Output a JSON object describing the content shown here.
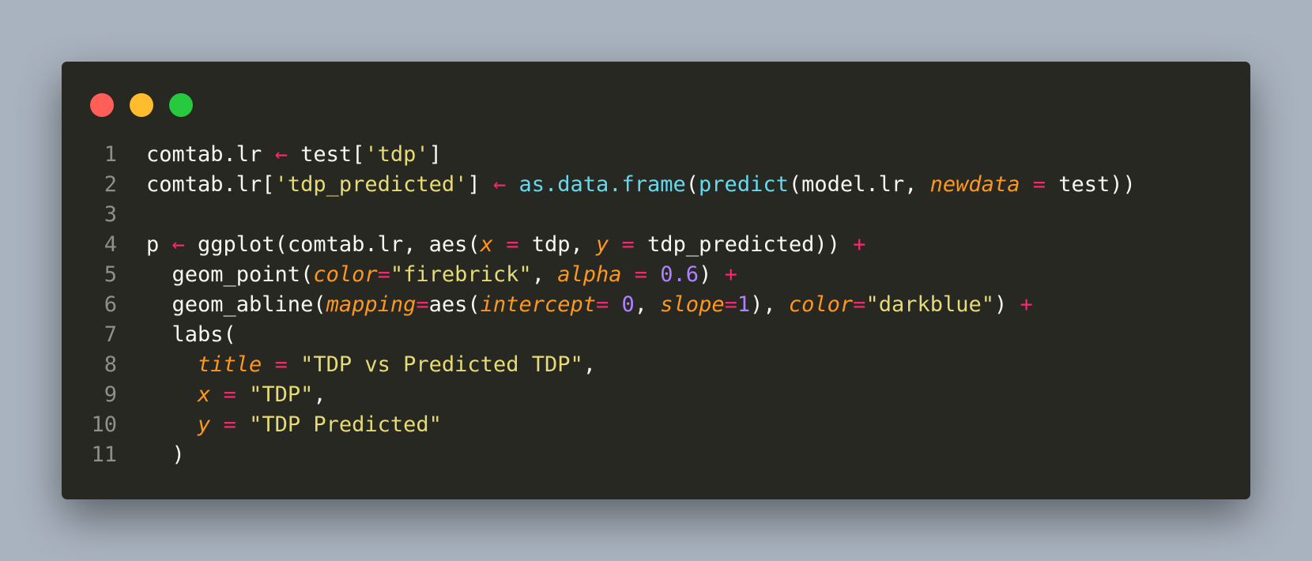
{
  "window": {
    "controls": [
      "close",
      "minimize",
      "maximize"
    ],
    "colors": {
      "background": "#272822",
      "close": "#ff5f56",
      "minimize": "#ffbd2e",
      "maximize": "#27c93f"
    }
  },
  "syntax_colors": {
    "default": "#f8f8f2",
    "operator": "#f92672",
    "string": "#e6db74",
    "function": "#66d9ef",
    "argument": "#fd971f",
    "number": "#ae81ff",
    "line_number": "#8f908a"
  },
  "code": {
    "lines": [
      {
        "n": "1",
        "tokens": [
          {
            "t": "comtab.lr ",
            "c": "plain"
          },
          {
            "t": "←",
            "c": "op"
          },
          {
            "t": " test[",
            "c": "plain"
          },
          {
            "t": "'tdp'",
            "c": "str"
          },
          {
            "t": "]",
            "c": "plain"
          }
        ]
      },
      {
        "n": "2",
        "tokens": [
          {
            "t": "comtab.lr[",
            "c": "plain"
          },
          {
            "t": "'tdp_predicted'",
            "c": "str"
          },
          {
            "t": "] ",
            "c": "plain"
          },
          {
            "t": "←",
            "c": "op"
          },
          {
            "t": " ",
            "c": "plain"
          },
          {
            "t": "as.data.frame",
            "c": "fn"
          },
          {
            "t": "(",
            "c": "plain"
          },
          {
            "t": "predict",
            "c": "fn"
          },
          {
            "t": "(model.lr, ",
            "c": "plain"
          },
          {
            "t": "newdata",
            "c": "arg"
          },
          {
            "t": " ",
            "c": "plain"
          },
          {
            "t": "=",
            "c": "op"
          },
          {
            "t": " test))",
            "c": "plain"
          }
        ]
      },
      {
        "n": "3",
        "tokens": []
      },
      {
        "n": "4",
        "tokens": [
          {
            "t": "p ",
            "c": "plain"
          },
          {
            "t": "←",
            "c": "op"
          },
          {
            "t": " ggplot(comtab.lr, aes(",
            "c": "plain"
          },
          {
            "t": "x",
            "c": "arg"
          },
          {
            "t": " ",
            "c": "plain"
          },
          {
            "t": "=",
            "c": "op"
          },
          {
            "t": " tdp, ",
            "c": "plain"
          },
          {
            "t": "y",
            "c": "arg"
          },
          {
            "t": " ",
            "c": "plain"
          },
          {
            "t": "=",
            "c": "op"
          },
          {
            "t": " tdp_predicted)) ",
            "c": "plain"
          },
          {
            "t": "+",
            "c": "op"
          }
        ]
      },
      {
        "n": "5",
        "tokens": [
          {
            "t": "  geom_point(",
            "c": "plain"
          },
          {
            "t": "color",
            "c": "arg"
          },
          {
            "t": "=",
            "c": "op"
          },
          {
            "t": "\"firebrick\"",
            "c": "str"
          },
          {
            "t": ", ",
            "c": "plain"
          },
          {
            "t": "alpha",
            "c": "arg"
          },
          {
            "t": " ",
            "c": "plain"
          },
          {
            "t": "=",
            "c": "op"
          },
          {
            "t": " ",
            "c": "plain"
          },
          {
            "t": "0.6",
            "c": "num"
          },
          {
            "t": ") ",
            "c": "plain"
          },
          {
            "t": "+",
            "c": "op"
          }
        ]
      },
      {
        "n": "6",
        "tokens": [
          {
            "t": "  geom_abline(",
            "c": "plain"
          },
          {
            "t": "mapping",
            "c": "arg"
          },
          {
            "t": "=",
            "c": "op"
          },
          {
            "t": "aes(",
            "c": "plain"
          },
          {
            "t": "intercept",
            "c": "arg"
          },
          {
            "t": "=",
            "c": "op"
          },
          {
            "t": " ",
            "c": "plain"
          },
          {
            "t": "0",
            "c": "num"
          },
          {
            "t": ", ",
            "c": "plain"
          },
          {
            "t": "slope",
            "c": "arg"
          },
          {
            "t": "=",
            "c": "op"
          },
          {
            "t": "1",
            "c": "num"
          },
          {
            "t": "), ",
            "c": "plain"
          },
          {
            "t": "color",
            "c": "arg"
          },
          {
            "t": "=",
            "c": "op"
          },
          {
            "t": "\"darkblue\"",
            "c": "str"
          },
          {
            "t": ") ",
            "c": "plain"
          },
          {
            "t": "+",
            "c": "op"
          }
        ]
      },
      {
        "n": "7",
        "tokens": [
          {
            "t": "  labs(",
            "c": "plain"
          }
        ]
      },
      {
        "n": "8",
        "tokens": [
          {
            "t": "    ",
            "c": "plain"
          },
          {
            "t": "title",
            "c": "arg"
          },
          {
            "t": " ",
            "c": "plain"
          },
          {
            "t": "=",
            "c": "op"
          },
          {
            "t": " ",
            "c": "plain"
          },
          {
            "t": "\"TDP vs Predicted TDP\"",
            "c": "str"
          },
          {
            "t": ",",
            "c": "plain"
          }
        ]
      },
      {
        "n": "9",
        "tokens": [
          {
            "t": "    ",
            "c": "plain"
          },
          {
            "t": "x",
            "c": "arg"
          },
          {
            "t": " ",
            "c": "plain"
          },
          {
            "t": "=",
            "c": "op"
          },
          {
            "t": " ",
            "c": "plain"
          },
          {
            "t": "\"TDP\"",
            "c": "str"
          },
          {
            "t": ",",
            "c": "plain"
          }
        ]
      },
      {
        "n": "10",
        "tokens": [
          {
            "t": "    ",
            "c": "plain"
          },
          {
            "t": "y",
            "c": "arg"
          },
          {
            "t": " ",
            "c": "plain"
          },
          {
            "t": "=",
            "c": "op"
          },
          {
            "t": " ",
            "c": "plain"
          },
          {
            "t": "\"TDP Predicted\"",
            "c": "str"
          }
        ]
      },
      {
        "n": "11",
        "tokens": [
          {
            "t": "  )",
            "c": "plain"
          }
        ]
      }
    ]
  }
}
